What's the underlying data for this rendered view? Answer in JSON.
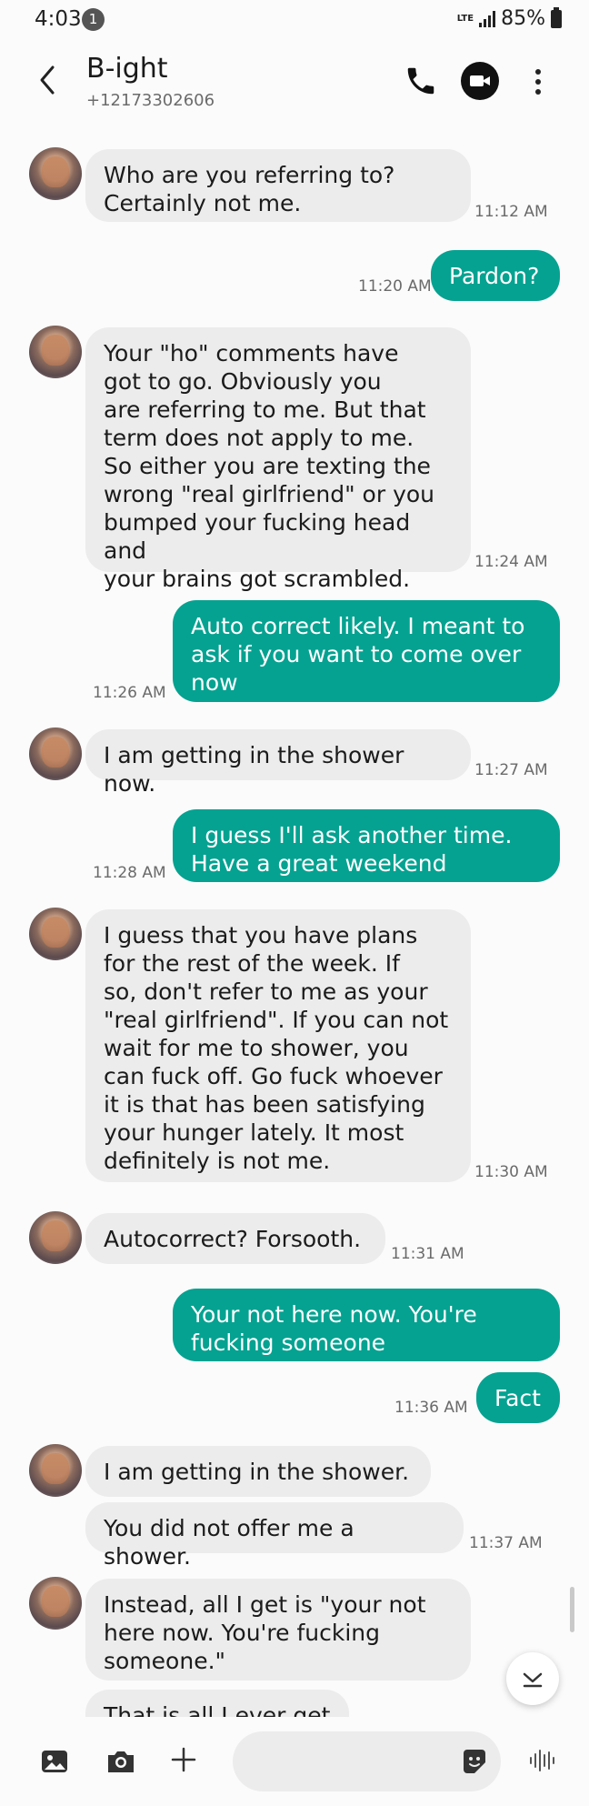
{
  "status_bar": {
    "time": "4:03",
    "notification_count": "1",
    "network": "LTE",
    "battery": "85%"
  },
  "header": {
    "contact_name": "B-ight",
    "phone_number": "+12173302606"
  },
  "icons": {
    "back": "chevron-left-icon",
    "call": "phone-icon",
    "video": "video-camera-icon",
    "more": "more-vertical-icon",
    "gallery": "image-icon",
    "camera": "camera-icon",
    "add": "plus-icon",
    "sticker": "sticker-icon",
    "voice": "voice-wave-icon",
    "scroll_down": "chevron-down-icon"
  },
  "colors": {
    "outgoing_bubble": "#05a291",
    "incoming_bubble": "#ececec",
    "background": "#fbfbfb"
  },
  "messages": [
    {
      "direction": "in",
      "text": "Who are you referring to?\nCertainly not me.",
      "time": "11:12 AM"
    },
    {
      "direction": "out",
      "text": "Pardon?",
      "time": "11:20 AM"
    },
    {
      "direction": "in",
      "text": "Your \"ho\" comments have\ngot to go.  Obviously you\nare referring to me.  But that\nterm does not apply to me.\nSo either you are texting the\nwrong \"real girlfriend\" or you\nbumped your fucking head and\nyour brains got scrambled.",
      "time": "11:24 AM"
    },
    {
      "direction": "out",
      "text": "Auto correct likely. I meant to\nask if you want to come over\nnow",
      "time": "11:26 AM"
    },
    {
      "direction": "in",
      "text": "I am getting in the shower now.",
      "time": "11:27 AM"
    },
    {
      "direction": "out",
      "text": "I guess I'll ask another time.\nHave a great weekend",
      "time": "11:28 AM"
    },
    {
      "direction": "in",
      "text": "I guess that you have plans\nfor the rest of the week.  If\nso, don't refer to me as your\n\"real girlfriend\".  If you can not\nwait for me to shower, you\ncan fuck off.  Go fuck whoever\nit is that has been satisfying\nyour hunger lately.  It most\ndefinitely is not me.",
      "time": "11:30 AM"
    },
    {
      "direction": "in",
      "text": "Autocorrect?  Forsooth.",
      "time": "11:31 AM"
    },
    {
      "direction": "out",
      "text": "Your not here now. You're\nfucking someone",
      "time": ""
    },
    {
      "direction": "out",
      "text": "Fact",
      "time": "11:36 AM"
    },
    {
      "direction": "in",
      "text": "I am getting in the shower.",
      "time": ""
    },
    {
      "direction": "in",
      "text": "You did not offer me a shower.",
      "time": "11:37 AM"
    },
    {
      "direction": "in",
      "text": "Instead, all I get is \"your not\nhere now. You're fucking\nsomeone.\"",
      "time": ""
    },
    {
      "direction": "in",
      "text": "That is all I ever get",
      "time": ""
    }
  ],
  "composer": {
    "placeholder": ""
  }
}
